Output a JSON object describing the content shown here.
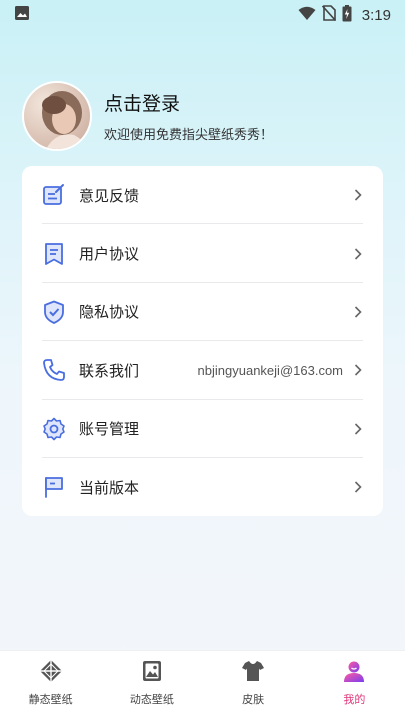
{
  "status_bar": {
    "time": "3:19"
  },
  "profile": {
    "title": "点击登录",
    "subtitle": "欢迎使用免费指尖壁纸秀秀！"
  },
  "menu": {
    "items": [
      {
        "label": "意见反馈",
        "icon": "feedback-icon",
        "value": ""
      },
      {
        "label": "用户协议",
        "icon": "bookmark-document-icon",
        "value": ""
      },
      {
        "label": "隐私协议",
        "icon": "shield-check-icon",
        "value": ""
      },
      {
        "label": "联系我们",
        "icon": "phone-icon",
        "value": "nbjingyuankeji@163.com"
      },
      {
        "label": "账号管理",
        "icon": "gear-icon",
        "value": ""
      },
      {
        "label": "当前版本",
        "icon": "flag-icon",
        "value": ""
      }
    ]
  },
  "tabs": [
    {
      "label": "静态壁纸",
      "icon": "diamond-icon"
    },
    {
      "label": "动态壁纸",
      "icon": "picture-icon"
    },
    {
      "label": "皮肤",
      "icon": "tshirt-icon"
    },
    {
      "label": "我的",
      "icon": "user-icon",
      "active": true
    }
  ],
  "colors": {
    "accent_blue": "#4a6ee0",
    "active_tab": "#e0367a"
  }
}
